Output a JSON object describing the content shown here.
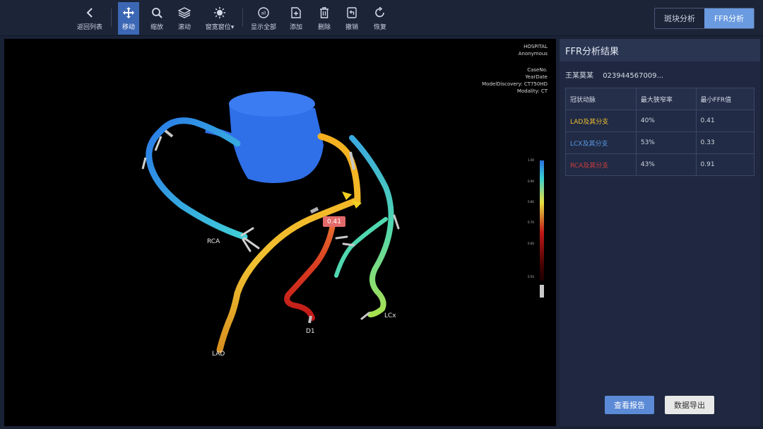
{
  "toolbar": {
    "tools": [
      {
        "id": "back",
        "label": "返回列表",
        "icon": "chevron-left-icon"
      },
      {
        "id": "move",
        "label": "移动",
        "icon": "move-arrows-icon",
        "active": true
      },
      {
        "id": "zoom",
        "label": "缩放",
        "icon": "magnifier-icon"
      },
      {
        "id": "scroll",
        "label": "滚动",
        "icon": "layers-icon"
      },
      {
        "id": "window",
        "label": "窗宽窗位",
        "icon": "brightness-icon"
      },
      {
        "id": "show_all",
        "label": "显示全部",
        "icon": "show-all-icon"
      },
      {
        "id": "add",
        "label": "添加",
        "icon": "add-file-icon"
      },
      {
        "id": "delete",
        "label": "删除",
        "icon": "trash-icon"
      },
      {
        "id": "undo",
        "label": "撤销",
        "icon": "undo-icon"
      },
      {
        "id": "redo",
        "label": "恢复",
        "icon": "redo-icon"
      }
    ],
    "tabs": [
      {
        "label": "斑块分析",
        "active": false
      },
      {
        "label": "FFR分析",
        "active": true
      }
    ]
  },
  "viewport": {
    "hospital": "HOSPITAL",
    "patient_name": "Anonymous",
    "case_no": "CaseNo.",
    "year_date": "YearDate",
    "model": "ModelDiscovery: CT750HD",
    "modality": "Modality: CT",
    "vessel_labels": {
      "rca": "RCA",
      "lad": "LAD",
      "d1": "D1",
      "lcx": "LCx"
    },
    "ffr_marker": "0.41",
    "scale_ticks": [
      "1.00",
      "0.90",
      "0.80",
      "0.70",
      "0.60",
      "0.50"
    ]
  },
  "panel": {
    "title": "FFR分析结果",
    "patient_name": "王某莫某",
    "patient_id": "023944567009...",
    "table": {
      "headers": [
        "冠状动脉",
        "最大狭窄率",
        "最小FFR值"
      ],
      "rows": [
        {
          "artery": "LAD及其分支",
          "stenosis": "40%",
          "ffr": "0.41",
          "color": "#f0c030"
        },
        {
          "artery": "LCX及其分支",
          "stenosis": "53%",
          "ffr": "0.33",
          "color": "#5b9ae8"
        },
        {
          "artery": "RCA及其分支",
          "stenosis": "43%",
          "ffr": "0.91",
          "color": "#d23c3c"
        }
      ]
    },
    "buttons": {
      "report": "查看报告",
      "export": "数据导出"
    }
  }
}
